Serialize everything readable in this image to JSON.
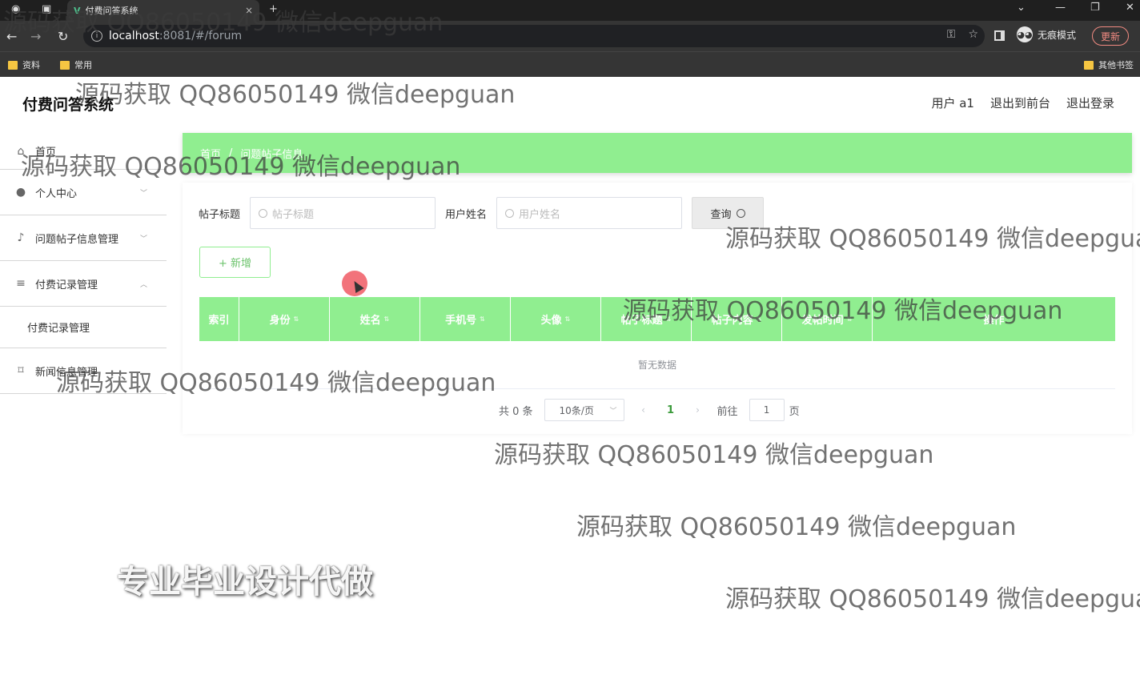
{
  "browser": {
    "tab_title": "付费问答系统",
    "tab_close": "×",
    "new_tab": "+",
    "url_host": "localhost",
    "url_path": ":8081/#/forum",
    "incognito_label": "无痕模式",
    "update_label": "更新",
    "bookmarks": [
      "资料",
      "常用"
    ],
    "other_bookmarks": "其他书签"
  },
  "app": {
    "title": "付费问答系统",
    "topnav": [
      "用户 a1",
      "退出到前台",
      "退出登录"
    ]
  },
  "sidebar": {
    "items": [
      {
        "label": "首页",
        "icon": "home-icon"
      },
      {
        "label": "个人中心",
        "icon": "user-icon"
      },
      {
        "label": "问题帖子信息管理",
        "icon": "mic-icon"
      },
      {
        "label": "付费记录管理",
        "icon": "sliders-icon"
      },
      {
        "label": "付费记录管理",
        "icon": ""
      },
      {
        "label": "新闻信息管理",
        "icon": "crop-icon"
      }
    ]
  },
  "breadcrumb": [
    "首页",
    "问题帖子信息"
  ],
  "search": {
    "title_label": "帖子标题",
    "title_placeholder": "帖子标题",
    "user_label": "用户姓名",
    "user_placeholder": "用户姓名",
    "query_label": "查询"
  },
  "add_button": "+ 新增",
  "table": {
    "headers": [
      "索引",
      "身份",
      "姓名",
      "手机号",
      "头像",
      "帖子标题",
      "帖子内容",
      "发帖时间",
      "操作"
    ],
    "empty_text": "暂无数据"
  },
  "pager": {
    "total": "共 0 条",
    "page_size": "10条/页",
    "current_page": "1",
    "goto_label": "前往",
    "goto_value": "1",
    "page_unit": "页"
  },
  "watermarks": [
    "源码获取 QQ86050149 微信deepguan",
    "源码获取 QQ86050149 微信deepguan",
    "源码获取 QQ86050149 微信deepguan",
    "源码获取 QQ86050149 微信deepguan",
    "源码获取 QQ86050149 微信deepguan",
    "源码获取 QQ86050149 微信deepguan",
    "源码获取 QQ86050149 微信deepguan",
    "源码获取 QQ86050149 微信deepguan",
    "源码获取 QQ86050149 微信deepguan"
  ],
  "promo_text": "专业毕业设计代做",
  "colors": {
    "accent": "#90ee90"
  }
}
